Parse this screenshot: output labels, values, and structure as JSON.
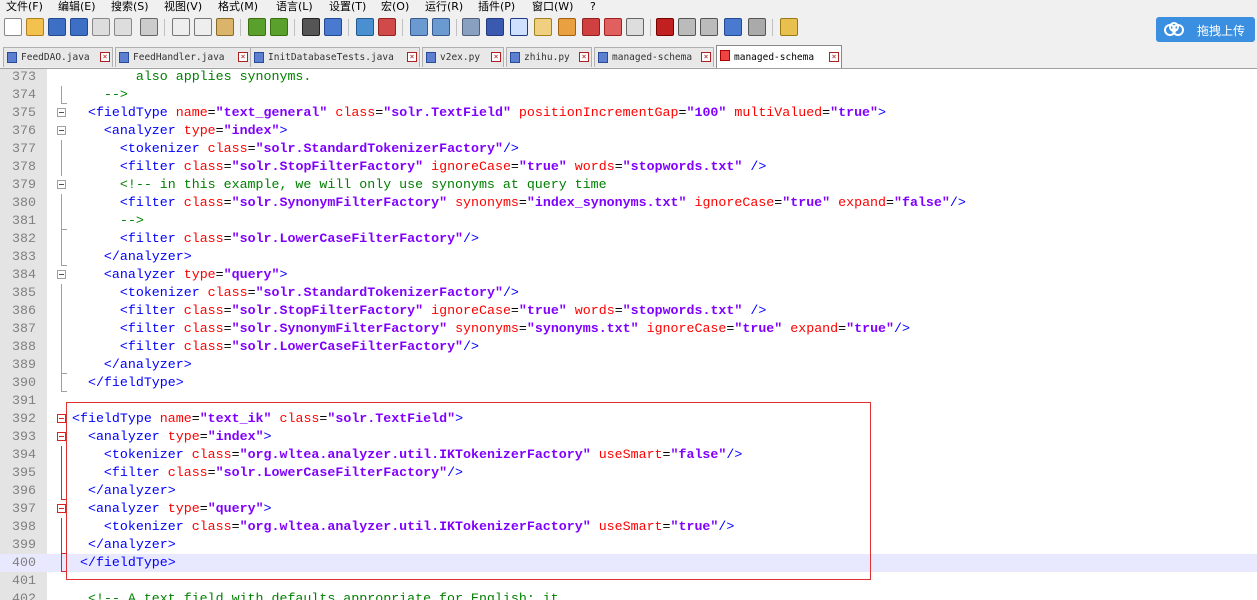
{
  "menu": [
    {
      "label": "文件(F)",
      "name": "menu-file"
    },
    {
      "label": "编辑(E)",
      "name": "menu-edit"
    },
    {
      "label": "搜索(S)",
      "name": "menu-search"
    },
    {
      "label": "视图(V)",
      "name": "menu-view"
    },
    {
      "label": "格式(M)",
      "name": "menu-format"
    },
    {
      "label": "语言(L)",
      "name": "menu-language"
    },
    {
      "label": "设置(T)",
      "name": "menu-settings"
    },
    {
      "label": "宏(O)",
      "name": "menu-macro"
    },
    {
      "label": "运行(R)",
      "name": "menu-run"
    },
    {
      "label": "插件(P)",
      "name": "menu-plugins"
    },
    {
      "label": "窗口(W)",
      "name": "menu-window"
    },
    {
      "label": "?",
      "name": "menu-help"
    }
  ],
  "upload_button": {
    "label": "拖拽上传",
    "icon": "cloud-icon"
  },
  "tabs": [
    {
      "label": "FeedDAO.java",
      "active": false
    },
    {
      "label": "FeedHandler.java",
      "active": false
    },
    {
      "label": "InitDatabaseTests.java",
      "active": false
    },
    {
      "label": "v2ex.py",
      "active": false
    },
    {
      "label": "zhihu.py",
      "active": false
    },
    {
      "label": "managed-schema",
      "active": false
    },
    {
      "label": "managed-schema",
      "active": true
    }
  ],
  "editor": {
    "current_line": 400,
    "lines": [
      {
        "n": "373",
        "text": "        also applies synonyms."
      },
      {
        "n": "374",
        "text": "    -->"
      },
      {
        "n": "375",
        "text": "  <fieldType name=\"text_general\" class=\"solr.TextField\" positionIncrementGap=\"100\" multiValued=\"true\">"
      },
      {
        "n": "376",
        "text": "    <analyzer type=\"index\">"
      },
      {
        "n": "377",
        "text": "      <tokenizer class=\"solr.StandardTokenizerFactory\"/>"
      },
      {
        "n": "378",
        "text": "      <filter class=\"solr.StopFilterFactory\" ignoreCase=\"true\" words=\"stopwords.txt\" />"
      },
      {
        "n": "379",
        "text": "      <!-- in this example, we will only use synonyms at query time"
      },
      {
        "n": "380",
        "text": "      <filter class=\"solr.SynonymFilterFactory\" synonyms=\"index_synonyms.txt\" ignoreCase=\"true\" expand=\"false\"/>"
      },
      {
        "n": "381",
        "text": "      -->"
      },
      {
        "n": "382",
        "text": "      <filter class=\"solr.LowerCaseFilterFactory\"/>"
      },
      {
        "n": "383",
        "text": "    </analyzer>"
      },
      {
        "n": "384",
        "text": "    <analyzer type=\"query\">"
      },
      {
        "n": "385",
        "text": "      <tokenizer class=\"solr.StandardTokenizerFactory\"/>"
      },
      {
        "n": "386",
        "text": "      <filter class=\"solr.StopFilterFactory\" ignoreCase=\"true\" words=\"stopwords.txt\" />"
      },
      {
        "n": "387",
        "text": "      <filter class=\"solr.SynonymFilterFactory\" synonyms=\"synonyms.txt\" ignoreCase=\"true\" expand=\"true\"/>"
      },
      {
        "n": "388",
        "text": "      <filter class=\"solr.LowerCaseFilterFactory\"/>"
      },
      {
        "n": "389",
        "text": "    </analyzer>"
      },
      {
        "n": "390",
        "text": "  </fieldType>"
      },
      {
        "n": "391",
        "text": ""
      },
      {
        "n": "392",
        "text": "<fieldType name=\"text_ik\" class=\"solr.TextField\">"
      },
      {
        "n": "393",
        "text": "  <analyzer type=\"index\">"
      },
      {
        "n": "394",
        "text": "    <tokenizer class=\"org.wltea.analyzer.util.IKTokenizerFactory\" useSmart=\"false\"/>"
      },
      {
        "n": "395",
        "text": "    <filter class=\"solr.LowerCaseFilterFactory\"/>"
      },
      {
        "n": "396",
        "text": "  </analyzer>"
      },
      {
        "n": "397",
        "text": "  <analyzer type=\"query\">"
      },
      {
        "n": "398",
        "text": "    <tokenizer class=\"org.wltea.analyzer.util.IKTokenizerFactory\" useSmart=\"true\"/>"
      },
      {
        "n": "399",
        "text": "  </analyzer>"
      },
      {
        "n": "400",
        "text": " </fieldType>"
      },
      {
        "n": "401",
        "text": ""
      },
      {
        "n": "402",
        "text": "  <!-- A text field with defaults appropriate for English: it"
      }
    ]
  },
  "colors": {
    "tag": "#0000ff",
    "attribute": "#ff0000",
    "value": "#8000ff",
    "comment": "#008000",
    "highlight_box": "#e03030",
    "current_line": "#e8e8ff",
    "upload_button": "#3b8fe0"
  }
}
